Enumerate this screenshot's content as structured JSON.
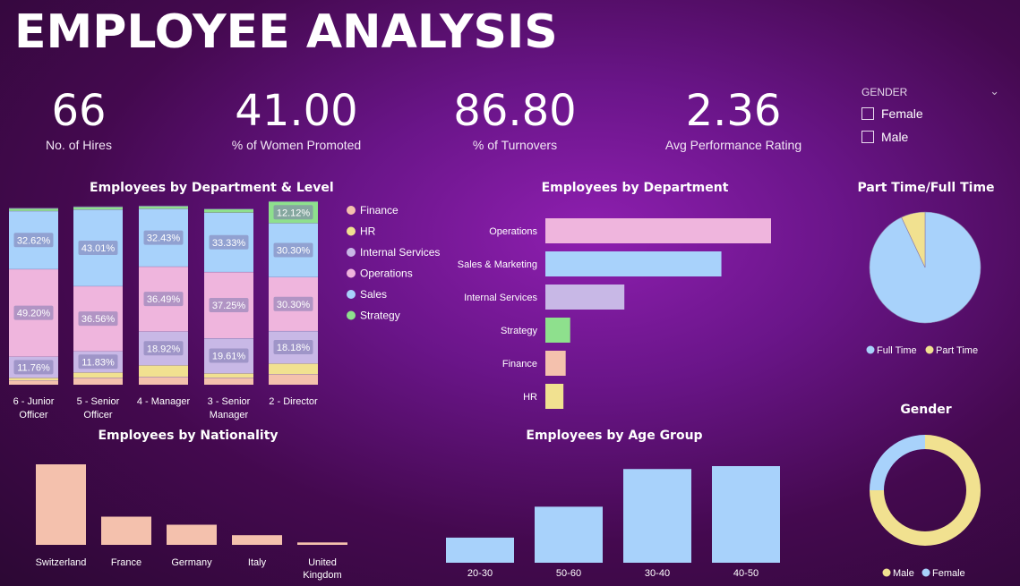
{
  "header": {
    "title": "EMPLOYEE ANALYSIS"
  },
  "kpis": [
    {
      "value": "66",
      "label": "No. of Hires"
    },
    {
      "value": "41.00",
      "label": "% of Women Promoted"
    },
    {
      "value": "86.80",
      "label": "% of Turnovers"
    },
    {
      "value": "2.36",
      "label": "Avg Performance Rating"
    }
  ],
  "slicer": {
    "title": "GENDER",
    "options": [
      "Female",
      "Male"
    ]
  },
  "colors": {
    "Finance": "#f4c1ad",
    "HR": "#f1e190",
    "Internal Services": "#c8b8e6",
    "Operations": "#efb5dd",
    "Sales": "#a8d2fb",
    "Strategy": "#8ee08d",
    "Sales & Marketing": "#a8d2fb"
  },
  "chart_data": [
    {
      "type": "bar",
      "stacked": "100%",
      "title": "Employees by Department & Level",
      "categories": [
        "6 - Junior Officer",
        "5 - Senior Officer",
        "4 - Manager",
        "3 - Senior Manager",
        "2 - Director"
      ],
      "series": [
        {
          "name": "Finance",
          "values": [
            2.5,
            4.0,
            4.5,
            4.0,
            6.0
          ],
          "labels": [
            "",
            "",
            "",
            "",
            ""
          ]
        },
        {
          "name": "HR",
          "values": [
            1.5,
            3.0,
            6.5,
            2.5,
            6.0
          ],
          "labels": [
            "",
            "",
            "",
            "",
            ""
          ]
        },
        {
          "name": "Internal Services",
          "values": [
            11.76,
            11.83,
            18.92,
            19.61,
            18.18
          ],
          "labels": [
            "11.76%",
            "11.83%",
            "18.92%",
            "19.61%",
            "18.18%"
          ]
        },
        {
          "name": "Operations",
          "values": [
            49.2,
            36.56,
            36.49,
            37.25,
            30.3
          ],
          "labels": [
            "49.20%",
            "36.56%",
            "36.49%",
            "37.25%",
            "30.30%"
          ]
        },
        {
          "name": "Sales",
          "values": [
            32.62,
            43.01,
            32.43,
            33.33,
            30.3
          ],
          "labels": [
            "32.62%",
            "43.01%",
            "32.43%",
            "33.33%",
            "30.30%"
          ]
        },
        {
          "name": "Strategy",
          "values": [
            1.5,
            1.5,
            1.5,
            2.0,
            12.12
          ],
          "labels": [
            "",
            "",
            "",
            "",
            "12.12%"
          ]
        }
      ],
      "legend": "right"
    },
    {
      "type": "bar",
      "orientation": "horizontal",
      "title": "Employees by Department",
      "categories": [
        "Operations",
        "Sales & Marketing",
        "Internal Services",
        "Strategy",
        "Finance",
        "HR"
      ],
      "values": [
        100,
        78,
        35,
        11,
        9,
        8
      ]
    },
    {
      "type": "pie",
      "title": "Part Time/Full Time",
      "labels": [
        "Full Time",
        "Part Time"
      ],
      "values": [
        93,
        7
      ]
    },
    {
      "type": "bar",
      "title": "Employees by Nationality",
      "categories": [
        "Switzerland",
        "France",
        "Germany",
        "Italy",
        "United Kingdom"
      ],
      "values": [
        100,
        35,
        25,
        12,
        3
      ]
    },
    {
      "type": "bar",
      "title": "Employees by Age Group",
      "categories": [
        "20-30",
        "50-60",
        "30-40",
        "40-50"
      ],
      "values": [
        26,
        58,
        97,
        100
      ]
    },
    {
      "type": "pie",
      "donut": true,
      "title": "Gender",
      "labels": [
        "Male",
        "Female"
      ],
      "values": [
        75,
        25
      ]
    }
  ]
}
